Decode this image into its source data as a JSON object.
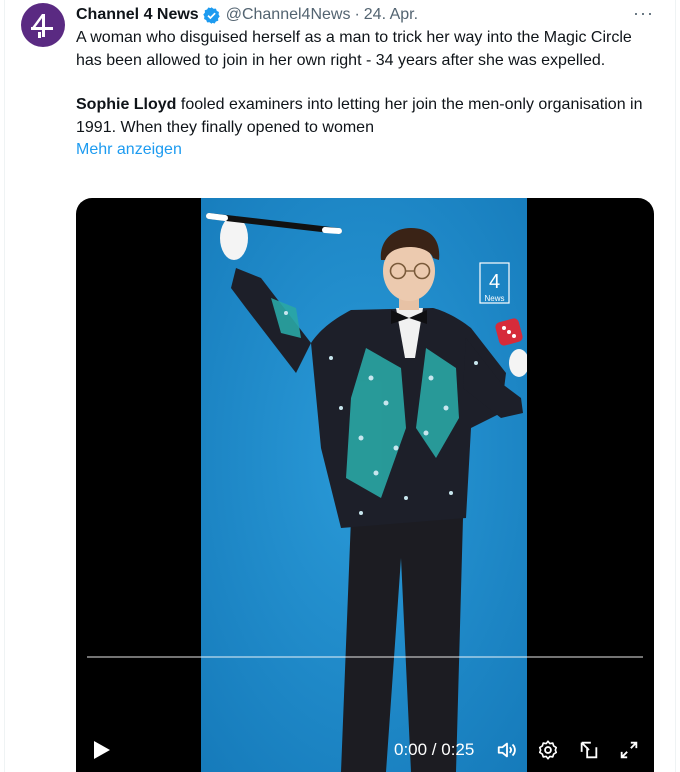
{
  "tweet": {
    "author_name": "Channel 4 News",
    "handle": "@Channel4News",
    "separator": "·",
    "date": "24. Apr.",
    "more_label": "···",
    "text_line1": "A woman who disguised herself as a man to trick her way into the Magic Circle has been allowed to join in her own right - 34 years after she was expelled.",
    "text_p2_bold": "Sophie Lloyd",
    "text_p2_rest": " fooled examiners into letting her join the men-only organisation in 1991. When they finally opened to women",
    "show_more": "Mehr anzeigen"
  },
  "video": {
    "watermark_line1": "4",
    "watermark_line2": "News",
    "time": "0:00 / 0:25",
    "progress_fraction": 0,
    "icons": [
      "play-icon",
      "volume-icon",
      "settings-icon",
      "minimize-icon",
      "fullscreen-icon"
    ]
  },
  "colors": {
    "link": "#1d9bf0",
    "secondary": "#536471",
    "avatar_bg": "#5a2a82",
    "photo_bg": "#1a86c9"
  }
}
